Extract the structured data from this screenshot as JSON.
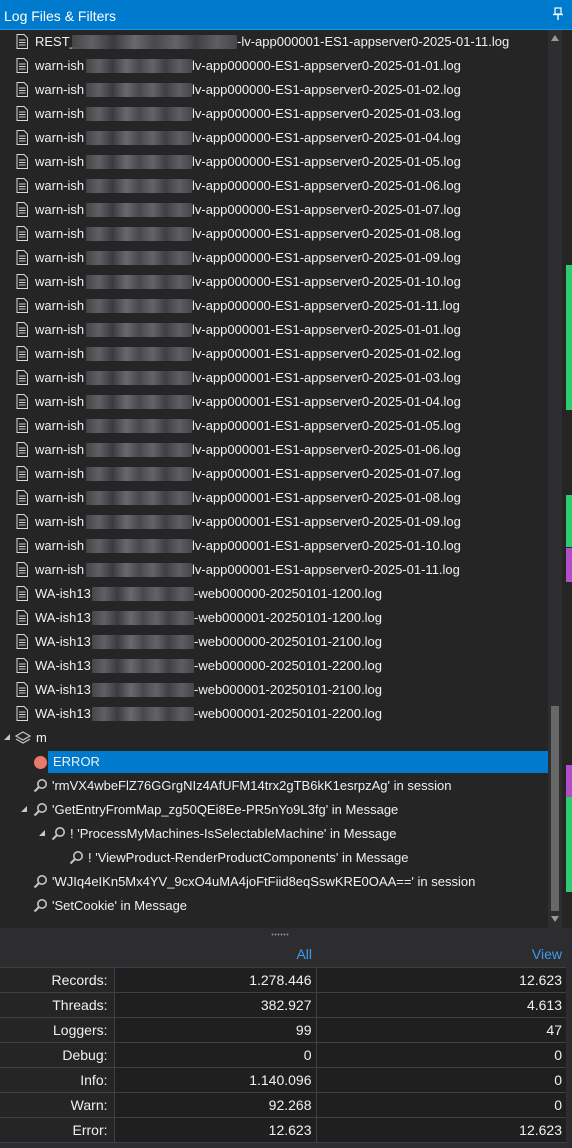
{
  "panel": {
    "title": "Log Files & Filters",
    "pin_icon": "pin-icon"
  },
  "files": [
    {
      "pre": "REST_",
      "post": "-lv-app000001-ES1-appserver0-2025-01-11.log"
    },
    {
      "pre": "warn-ish",
      "post": "lv-app000000-ES1-appserver0-2025-01-01.log"
    },
    {
      "pre": "warn-ish",
      "post": "lv-app000000-ES1-appserver0-2025-01-02.log"
    },
    {
      "pre": "warn-ish",
      "post": "lv-app000000-ES1-appserver0-2025-01-03.log"
    },
    {
      "pre": "warn-ish",
      "post": "lv-app000000-ES1-appserver0-2025-01-04.log"
    },
    {
      "pre": "warn-ish",
      "post": "lv-app000000-ES1-appserver0-2025-01-05.log"
    },
    {
      "pre": "warn-ish",
      "post": "lv-app000000-ES1-appserver0-2025-01-06.log"
    },
    {
      "pre": "warn-ish",
      "post": "lv-app000000-ES1-appserver0-2025-01-07.log"
    },
    {
      "pre": "warn-ish",
      "post": "lv-app000000-ES1-appserver0-2025-01-08.log"
    },
    {
      "pre": "warn-ish",
      "post": "lv-app000000-ES1-appserver0-2025-01-09.log"
    },
    {
      "pre": "warn-ish",
      "post": "lv-app000000-ES1-appserver0-2025-01-10.log"
    },
    {
      "pre": "warn-ish",
      "post": "lv-app000000-ES1-appserver0-2025-01-11.log"
    },
    {
      "pre": "warn-ish",
      "post": "lv-app000001-ES1-appserver0-2025-01-01.log"
    },
    {
      "pre": "warn-ish",
      "post": "lv-app000001-ES1-appserver0-2025-01-02.log"
    },
    {
      "pre": "warn-ish",
      "post": "lv-app000001-ES1-appserver0-2025-01-03.log"
    },
    {
      "pre": "warn-ish",
      "post": "lv-app000001-ES1-appserver0-2025-01-04.log"
    },
    {
      "pre": "warn-ish",
      "post": "lv-app000001-ES1-appserver0-2025-01-05.log"
    },
    {
      "pre": "warn-ish",
      "post": "lv-app000001-ES1-appserver0-2025-01-06.log"
    },
    {
      "pre": "warn-ish",
      "post": "lv-app000001-ES1-appserver0-2025-01-07.log"
    },
    {
      "pre": "warn-ish",
      "post": "lv-app000001-ES1-appserver0-2025-01-08.log"
    },
    {
      "pre": "warn-ish",
      "post": "lv-app000001-ES1-appserver0-2025-01-09.log"
    },
    {
      "pre": "warn-ish",
      "post": "lv-app000001-ES1-appserver0-2025-01-10.log"
    },
    {
      "pre": "warn-ish",
      "post": "lv-app000001-ES1-appserver0-2025-01-11.log"
    },
    {
      "pre": "WA-ish13",
      "post": "-web000000-20250101-1200.log"
    },
    {
      "pre": "WA-ish13",
      "post": "-web000001-20250101-1200.log"
    },
    {
      "pre": "WA-ish13",
      "post": "-web000000-20250101-2100.log"
    },
    {
      "pre": "WA-ish13",
      "post": "-web000000-20250101-2200.log"
    },
    {
      "pre": "WA-ish13",
      "post": "-web000001-20250101-2100.log"
    },
    {
      "pre": "WA-ish13",
      "post": "-web000001-20250101-2200.log"
    }
  ],
  "filter_group": {
    "label": "m"
  },
  "filters": [
    {
      "text": "ERROR",
      "icon": "error-dot-icon"
    },
    {
      "text": "'rmVX4wbeFlZ76GGrgNIz4AfUFM14trx2gTB6kK1esrpzAg' in session",
      "icon": "search-icon"
    },
    {
      "text": "'GetEntryFromMap_zg50QEi8Ee-PR5nYo9L3fg' in Message",
      "icon": "search-icon"
    },
    {
      "text": "! 'ProcessMyMachines-IsSelectableMachine' in Message",
      "icon": "search-icon"
    },
    {
      "text": "! 'ViewProduct-RenderProductComponents' in Message",
      "icon": "search-icon"
    },
    {
      "text": "'WJIq4eIKn5Mx4YV_9cxO4uMA4joFtFiid8eqSswKRE0OAA==' in session",
      "icon": "search-icon"
    },
    {
      "text": "'SetCookie' in Message",
      "icon": "search-icon"
    }
  ],
  "stats": {
    "headers": [
      "",
      "All",
      "View"
    ],
    "rows": [
      {
        "label": "Records:",
        "all": "1.278.446",
        "view": "12.623"
      },
      {
        "label": "Threads:",
        "all": "382.927",
        "view": "4.613"
      },
      {
        "label": "Loggers:",
        "all": "99",
        "view": "47"
      },
      {
        "label": "Debug:",
        "all": "0",
        "view": "0"
      },
      {
        "label": "Info:",
        "all": "1.140.096",
        "view": "0"
      },
      {
        "label": "Warn:",
        "all": "92.268",
        "view": "0"
      },
      {
        "label": "Error:",
        "all": "12.623",
        "view": "12.623"
      }
    ]
  },
  "colors": {
    "accent": "#007acc",
    "header_text": "#3c9cf0",
    "error_dot": "#e87a6b",
    "minimap_green": "#2ecc71",
    "minimap_magenta": "#b04fc8"
  }
}
